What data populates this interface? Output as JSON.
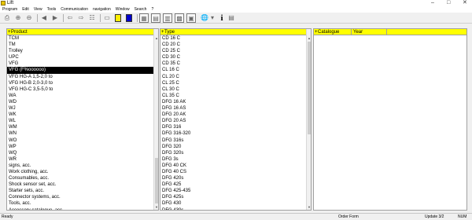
{
  "window": {
    "title": "Lift",
    "minimize": "–",
    "maximize": "□",
    "close": "✕"
  },
  "menu": [
    "Program",
    "Edit",
    "View",
    "Tools",
    "Communication",
    "navigation",
    "Window",
    "Search",
    "?"
  ],
  "toolbar": {
    "icons": [
      "print-icon",
      "zoom-in-icon",
      "zoom-out-icon",
      "back-icon",
      "forward-icon",
      "arrow-left-icon",
      "arrow-right-icon",
      "tree-view-icon",
      "document-icon",
      "yellow-square-icon",
      "blue-square-icon",
      "grid-view-icon",
      "list-view-icon",
      "table-view-icon",
      "tiles-view-icon",
      "tag-view-icon",
      "earth-icon",
      "info-icon",
      "catalogue-icon"
    ],
    "colors": {
      "yellow": "#ffee00",
      "blue": "#0000cc"
    }
  },
  "product_pane": {
    "header": "Product",
    "items": [
      "TCM",
      "TM",
      "Trolley",
      "UPC",
      "VFG",
      "VFG (F%oooooo)",
      "VFG HG-A 1,5-2,0 to",
      "VFG HG-B 2,0-3,0 to",
      "VFG HG-C 3,5-5,0 to",
      "WA",
      "WD",
      "WJ",
      "WK",
      "WL",
      "WM",
      "WN",
      "WO",
      "WP",
      "WQ",
      "WR",
      "signs, acc.",
      "Work clothing, acc.",
      "Consumables, acc.",
      "Shock sensor set, acc.",
      "Starter sets, acc.",
      "Connector systems, acc.",
      "Tools, acc.",
      "Accessory catalogue, acc.",
      "Accessory"
    ],
    "selected_index": 5
  },
  "type_pane": {
    "header": "Type",
    "items": [
      "CD 16 C",
      "CD 20 C",
      "CD 25 C",
      "CD 30 C",
      "CD 35 C",
      "CL 16 C",
      "CL 20 C",
      "CL 25 C",
      "CL 30 C",
      "CL 35 C",
      "DFG 16 AK",
      "DFG 16 AS",
      "DFG 20 AK",
      "DFG 20 AS",
      "DFG 316",
      "DFG 316-320",
      "DFG 316s",
      "DFG 320",
      "DFG 320s",
      "DFG 3s",
      "DFG 40 CK",
      "DFG 40 CS",
      "DFG 420s",
      "DFG 425",
      "DFG 425-435",
      "DFG 425s",
      "DFG 430",
      "DFG 430s",
      "DFG 435",
      "DFG 435..."
    ]
  },
  "catalogue_pane": {
    "headers": [
      "Catalogue",
      "Year"
    ]
  },
  "status": {
    "left": "Ready",
    "mid": "Order Form",
    "update": "Update 3/2",
    "num": "NUM"
  }
}
